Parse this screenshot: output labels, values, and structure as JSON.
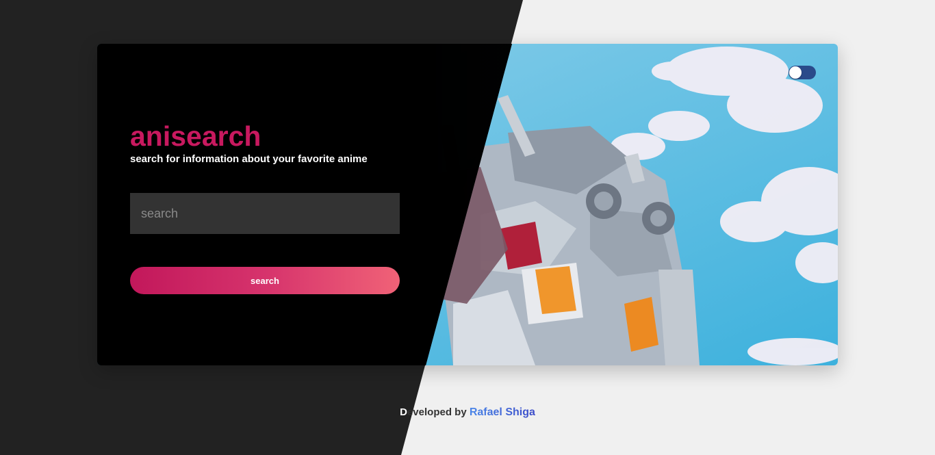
{
  "app": {
    "title": "anisearch",
    "subtitle": "search for information about your favorite anime"
  },
  "search": {
    "placeholder": "search",
    "value": "",
    "button_label": "search"
  },
  "theme_toggle": {
    "state": "light",
    "icon": "toggle-switch-icon"
  },
  "footer": {
    "prefix_first_letter": "D",
    "prefix_rest": "eveloped by ",
    "author": "Rafael Shiga"
  },
  "colors": {
    "brand": "#c8195f",
    "button_gradient_start": "#c2185b",
    "button_gradient_end": "#f06277",
    "dark_bg": "#222222",
    "light_bg": "#f0f0f0",
    "toggle": "#2a4a8a",
    "link": "#4a76d8"
  }
}
